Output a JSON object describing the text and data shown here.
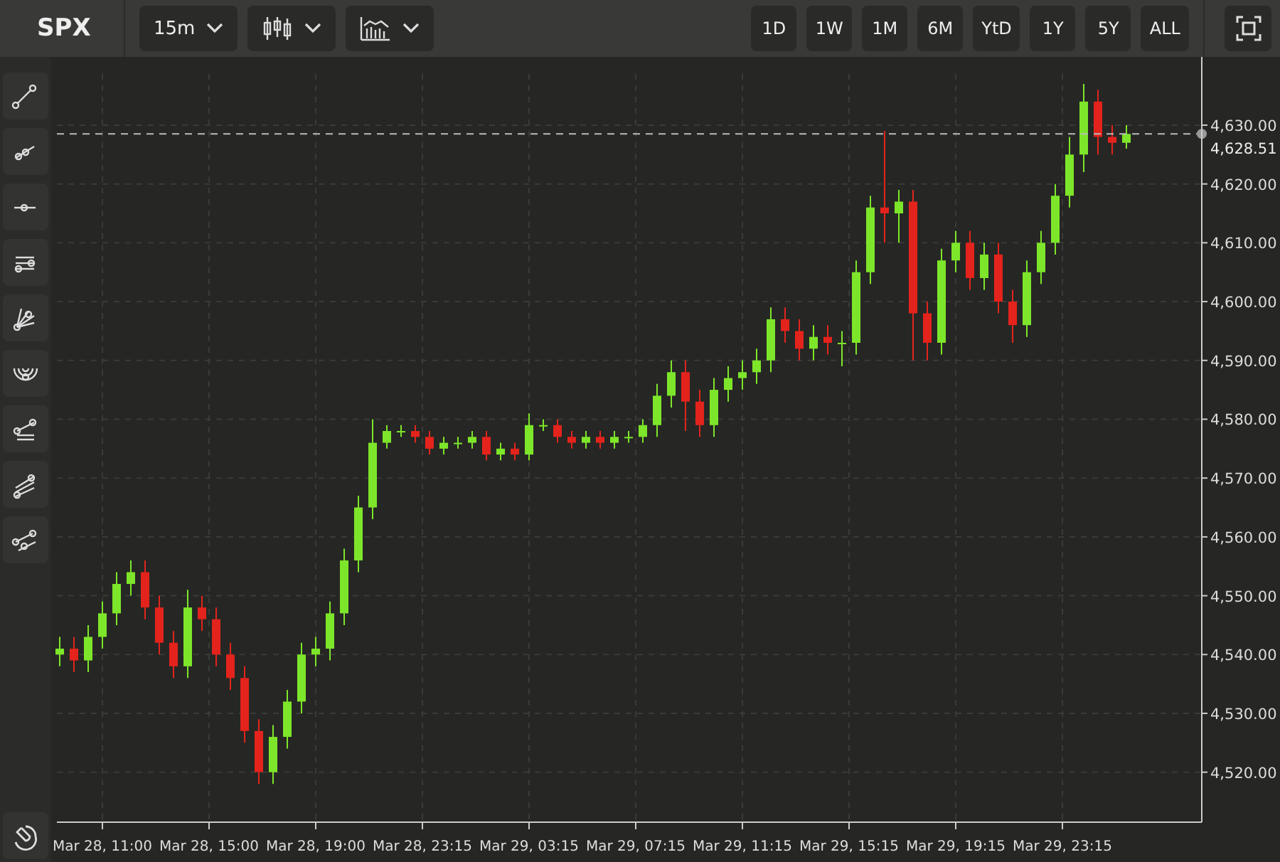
{
  "header": {
    "symbol": "SPX",
    "interval": "15m",
    "ranges": [
      {
        "label": "1D",
        "selected": false
      },
      {
        "label": "1W",
        "selected": false
      },
      {
        "label": "1M",
        "selected": false
      },
      {
        "label": "6M",
        "selected": false
      },
      {
        "label": "YtD",
        "selected": false
      },
      {
        "label": "1Y",
        "selected": false
      },
      {
        "label": "5Y",
        "selected": false
      },
      {
        "label": "ALL",
        "selected": false
      }
    ]
  },
  "chart": {
    "time_labels": [
      "Mar 28, 11:00",
      "Mar 28, 15:00",
      "Mar 28, 19:00",
      "Mar 28, 23:15",
      "Mar 29, 03:15",
      "Mar 29, 07:15",
      "Mar 29, 11:15",
      "Mar 29, 15:15",
      "Mar 29, 19:15",
      "Mar 29, 23:15"
    ],
    "chart_data": {
      "type": "candlestick",
      "grid": true,
      "ylim": [
        4511.5,
        4638.7
      ],
      "yticks": [
        {
          "value": 4630,
          "label": "4,630.00"
        },
        {
          "value": 4620,
          "label": "4,620.00"
        },
        {
          "value": 4610,
          "label": "4,610.00"
        },
        {
          "value": 4600,
          "label": "4,600.00"
        },
        {
          "value": 4590,
          "label": "4,590.00"
        },
        {
          "value": 4580,
          "label": "4,580.00"
        },
        {
          "value": 4570,
          "label": "4,570.00"
        },
        {
          "value": 4560,
          "label": "4,560.00"
        },
        {
          "value": 4550,
          "label": "4,550.00"
        },
        {
          "value": 4540,
          "label": "4,540.00"
        },
        {
          "value": 4530,
          "label": "4,530.00"
        },
        {
          "value": 4520,
          "label": "4,520.00"
        }
      ],
      "ref_lines": [
        {
          "axis": "y",
          "value": 4628.51,
          "label": "4,628.51"
        }
      ],
      "ohlc": [
        [
          4540,
          4543,
          4538,
          4541
        ],
        [
          4541,
          4543,
          4537,
          4539
        ],
        [
          4539,
          4545,
          4537,
          4543
        ],
        [
          4543,
          4549,
          4541,
          4547
        ],
        [
          4547,
          4554,
          4545,
          4552
        ],
        [
          4552,
          4556,
          4550,
          4554
        ],
        [
          4554,
          4556,
          4546,
          4548
        ],
        [
          4548,
          4550,
          4540,
          4542
        ],
        [
          4542,
          4544,
          4536,
          4538
        ],
        [
          4538,
          4551,
          4536,
          4548
        ],
        [
          4548,
          4550,
          4544,
          4546
        ],
        [
          4546,
          4548,
          4538,
          4540
        ],
        [
          4540,
          4542,
          4534,
          4536
        ],
        [
          4536,
          4538,
          4525,
          4527
        ],
        [
          4527,
          4529,
          4518,
          4520
        ],
        [
          4520,
          4528,
          4518,
          4526
        ],
        [
          4526,
          4534,
          4524,
          4532
        ],
        [
          4532,
          4542,
          4530,
          4540
        ],
        [
          4540,
          4543,
          4538,
          4541
        ],
        [
          4541,
          4549,
          4539,
          4547
        ],
        [
          4547,
          4558,
          4545,
          4556
        ],
        [
          4556,
          4567,
          4554,
          4565
        ],
        [
          4565,
          4580,
          4563,
          4576
        ],
        [
          4576,
          4579,
          4575,
          4578
        ],
        [
          4578,
          4579,
          4577,
          4578
        ],
        [
          4578,
          4579,
          4576,
          4577
        ],
        [
          4577,
          4578,
          4574,
          4575
        ],
        [
          4575,
          4577,
          4574,
          4576
        ],
        [
          4576,
          4577,
          4575,
          4576
        ],
        [
          4576,
          4578,
          4575,
          4577
        ],
        [
          4577,
          4578,
          4573,
          4574
        ],
        [
          4574,
          4576,
          4573,
          4575
        ],
        [
          4575,
          4576,
          4573,
          4574
        ],
        [
          4574,
          4581,
          4573,
          4579
        ],
        [
          4579,
          4580,
          4578,
          4579
        ],
        [
          4579,
          4580,
          4576,
          4577
        ],
        [
          4577,
          4578,
          4575,
          4576
        ],
        [
          4576,
          4578,
          4575,
          4577
        ],
        [
          4577,
          4578,
          4575,
          4576
        ],
        [
          4576,
          4578,
          4575,
          4577
        ],
        [
          4577,
          4578,
          4576,
          4577
        ],
        [
          4577,
          4580,
          4576,
          4579
        ],
        [
          4579,
          4586,
          4577,
          4584
        ],
        [
          4584,
          4590,
          4582,
          4588
        ],
        [
          4588,
          4590,
          4578,
          4583
        ],
        [
          4583,
          4585,
          4577,
          4579
        ],
        [
          4579,
          4587,
          4577,
          4585
        ],
        [
          4585,
          4589,
          4583,
          4587
        ],
        [
          4587,
          4590,
          4585,
          4588
        ],
        [
          4588,
          4592,
          4586,
          4590
        ],
        [
          4590,
          4599,
          4588,
          4597
        ],
        [
          4597,
          4599,
          4593,
          4595
        ],
        [
          4595,
          4597,
          4590,
          4592
        ],
        [
          4592,
          4596,
          4590,
          4594
        ],
        [
          4594,
          4596,
          4591,
          4593
        ],
        [
          4593,
          4595,
          4589,
          4593
        ],
        [
          4593,
          4607,
          4591,
          4605
        ],
        [
          4605,
          4618,
          4603,
          4616
        ],
        [
          4616,
          4629,
          4610,
          4615
        ],
        [
          4615,
          4619,
          4610,
          4617
        ],
        [
          4617,
          4619,
          4590,
          4598
        ],
        [
          4598,
          4600,
          4590,
          4593
        ],
        [
          4593,
          4609,
          4591,
          4607
        ],
        [
          4607,
          4612,
          4605,
          4610
        ],
        [
          4610,
          4612,
          4602,
          4604
        ],
        [
          4604,
          4610,
          4602,
          4608
        ],
        [
          4608,
          4610,
          4598,
          4600
        ],
        [
          4600,
          4602,
          4593,
          4596
        ],
        [
          4596,
          4607,
          4594,
          4605
        ],
        [
          4605,
          4612,
          4603,
          4610
        ],
        [
          4610,
          4620,
          4608,
          4618
        ],
        [
          4618,
          4628,
          4616,
          4625
        ],
        [
          4625,
          4637,
          4622,
          4634
        ],
        [
          4634,
          4636,
          4625,
          4628
        ],
        [
          4628,
          4630,
          4625,
          4627
        ],
        [
          4627,
          4630,
          4626,
          4628.51
        ]
      ]
    }
  }
}
